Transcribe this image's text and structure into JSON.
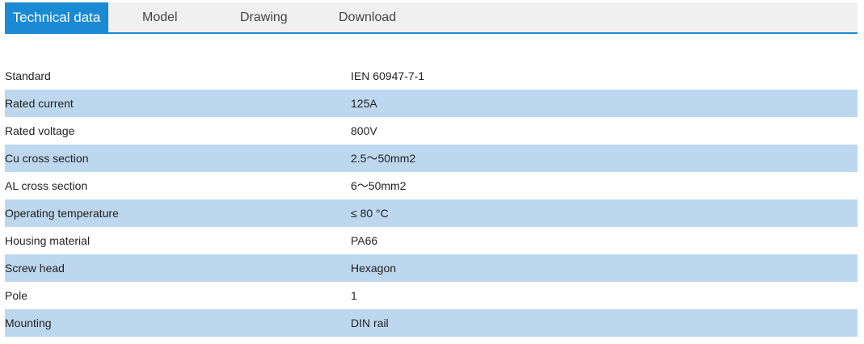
{
  "tabs": [
    {
      "label": "Technical data",
      "active": true
    },
    {
      "label": "Model",
      "active": false
    },
    {
      "label": "Drawing",
      "active": false
    },
    {
      "label": "Download",
      "active": false
    }
  ],
  "colors": {
    "accent": "#1a8ad4",
    "row_alt": "#bdd7ee",
    "tabbar_bg": "#f0f0f0"
  },
  "specs": [
    {
      "label": "Standard",
      "value": "IEN 60947-7-1"
    },
    {
      "label": "Rated current",
      "value": "125A"
    },
    {
      "label": "Rated voltage",
      "value": "800V"
    },
    {
      "label": "Cu cross section",
      "value": "2.5～50mm2"
    },
    {
      "label": "AL cross section",
      "value": "6～50mm2"
    },
    {
      "label": "Operating temperature",
      "value": "≤ 80 °C"
    },
    {
      "label": "Housing material",
      "value": "PA66"
    },
    {
      "label": "Screw head",
      "value": "Hexagon"
    },
    {
      "label": "Pole",
      "value": "1"
    },
    {
      "label": "Mounting",
      "value": "DIN rail"
    }
  ]
}
